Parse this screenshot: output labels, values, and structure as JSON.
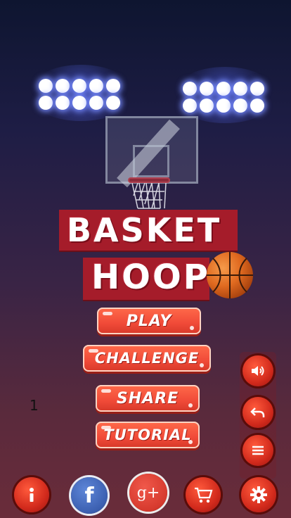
{
  "game": {
    "title_line1": "BASKET",
    "title_line2": "HOOP"
  },
  "menu": {
    "play": "PLAY",
    "challenge": "CHALLENGE",
    "share": "SHARE",
    "tutorial": "TUTORIAL"
  },
  "side_buttons": [
    "speaker-icon",
    "undo-icon",
    "menu-bars-icon"
  ],
  "bottom_buttons": [
    "info-icon",
    "facebook-icon",
    "google-plus-icon",
    "cart-icon",
    "gear-icon"
  ],
  "bottom_labels": {
    "facebook": "f",
    "google_plus": "g+"
  },
  "overlay_number": "1",
  "colors": {
    "button": "#f04a38",
    "banner": "#a51c2a",
    "ball": "#e06a20",
    "facebook": "#3b5fb0"
  }
}
